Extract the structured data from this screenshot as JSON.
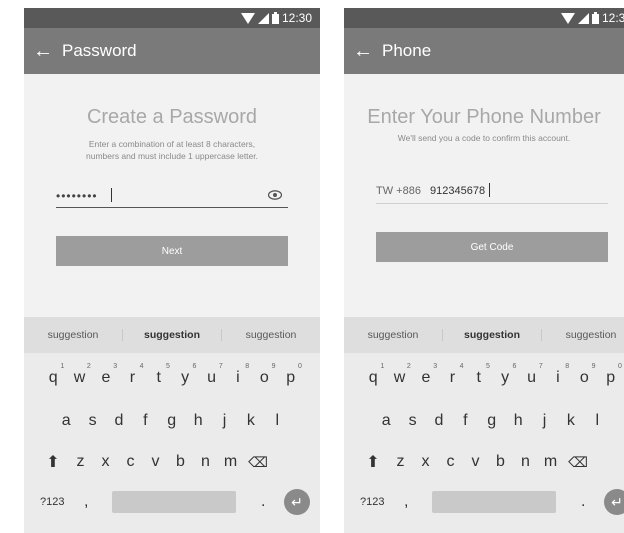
{
  "status_bar": {
    "time": "12:30"
  },
  "keyboard": {
    "suggestions": [
      "suggestion",
      "suggestion",
      "suggestion"
    ],
    "row1": [
      {
        "key": "q",
        "hint": "1"
      },
      {
        "key": "w",
        "hint": "2"
      },
      {
        "key": "e",
        "hint": "3"
      },
      {
        "key": "r",
        "hint": "4"
      },
      {
        "key": "t",
        "hint": "5"
      },
      {
        "key": "y",
        "hint": "6"
      },
      {
        "key": "u",
        "hint": "7"
      },
      {
        "key": "i",
        "hint": "8"
      },
      {
        "key": "o",
        "hint": "9"
      },
      {
        "key": "p",
        "hint": "0"
      }
    ],
    "row2": [
      "a",
      "s",
      "d",
      "f",
      "g",
      "h",
      "j",
      "k",
      "l"
    ],
    "row3": [
      "z",
      "x",
      "c",
      "v",
      "b",
      "n",
      "m"
    ],
    "symbols_label": "?123",
    "comma": ",",
    "period": "."
  },
  "password_screen": {
    "title": "Password",
    "heading": "Create a Password",
    "description_line1": "Enter a combination of at least 8 characters,",
    "description_line2": "numbers and must include 1 uppercase letter.",
    "password_value": "••••••••",
    "next_label": "Next"
  },
  "phone_screen": {
    "title": "Phone",
    "heading": "Enter Your Phone Number",
    "description": "We'll send you a code to confirm this account.",
    "country_code": "TW +886",
    "phone_value": "912345678",
    "get_code_label": "Get Code"
  }
}
